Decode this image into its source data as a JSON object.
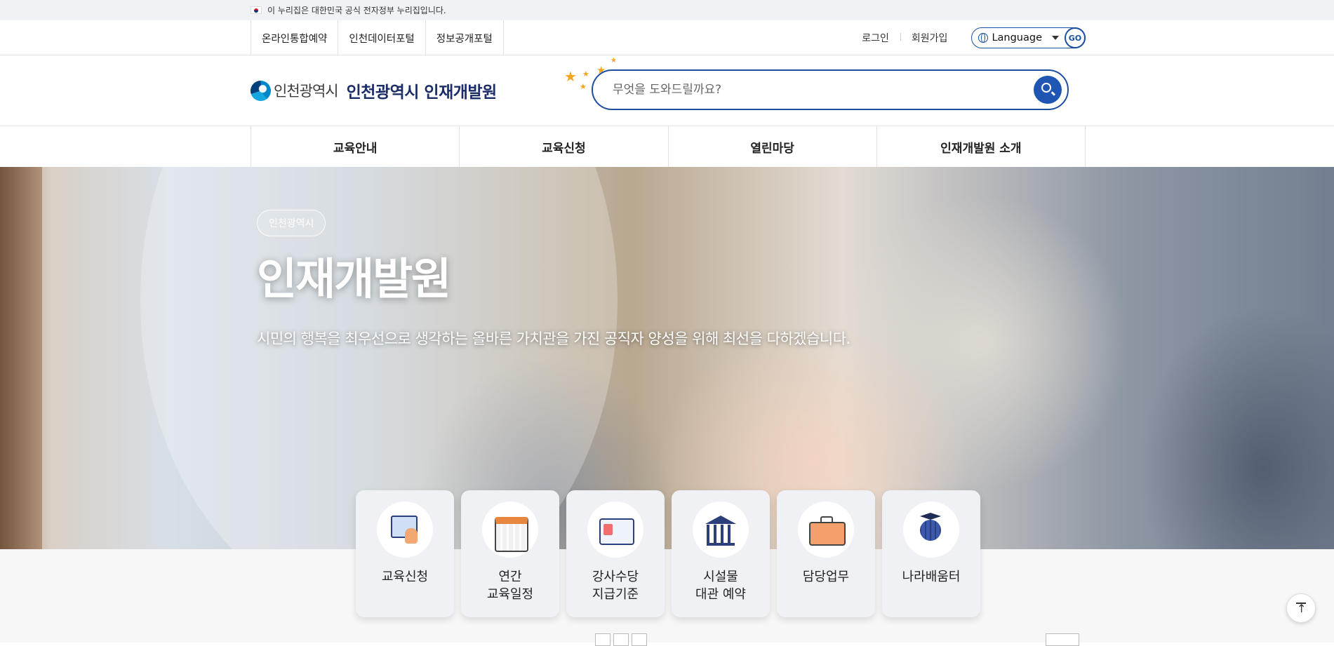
{
  "gov_banner": {
    "text": "이 누리집은 대한민국 공식 전자정부 누리집입니다."
  },
  "util": {
    "portal_links": [
      "온라인통합예약",
      "인천데이터포털",
      "정보공개포털"
    ],
    "login": "로그인",
    "signup": "회원가입",
    "language_label": "Language",
    "go_label": "GO"
  },
  "header": {
    "logo_city": "인천광역시",
    "logo_title": "인천광역시 인재개발원",
    "search_placeholder": "무엇을 도와드릴까요?"
  },
  "gnb": [
    "교육안내",
    "교육신청",
    "열린마당",
    "인재개발원 소개"
  ],
  "hero": {
    "tag": "인천광역시",
    "title": "인재개발원",
    "subtitle": "시민의 행복을 최우선으로 생각하는 올바른 가치관을 가진 공직자 양성을 위해 최선을 다하겠습니다."
  },
  "quick_menu": [
    {
      "label": "교육신청",
      "icon": "apply-icon"
    },
    {
      "label": "연간\n교육일정",
      "icon": "calendar-icon"
    },
    {
      "label": "강사수당\n지급기준",
      "icon": "id-card-icon"
    },
    {
      "label": "시설물\n대관 예약",
      "icon": "building-icon"
    },
    {
      "label": "담당업무",
      "icon": "briefcase-icon"
    },
    {
      "label": "나라배움터",
      "icon": "globe-graduate-icon"
    }
  ],
  "colors": {
    "primary": "#1f4e9e",
    "star": "#f4a51d",
    "title_navy": "#1a2d68"
  }
}
